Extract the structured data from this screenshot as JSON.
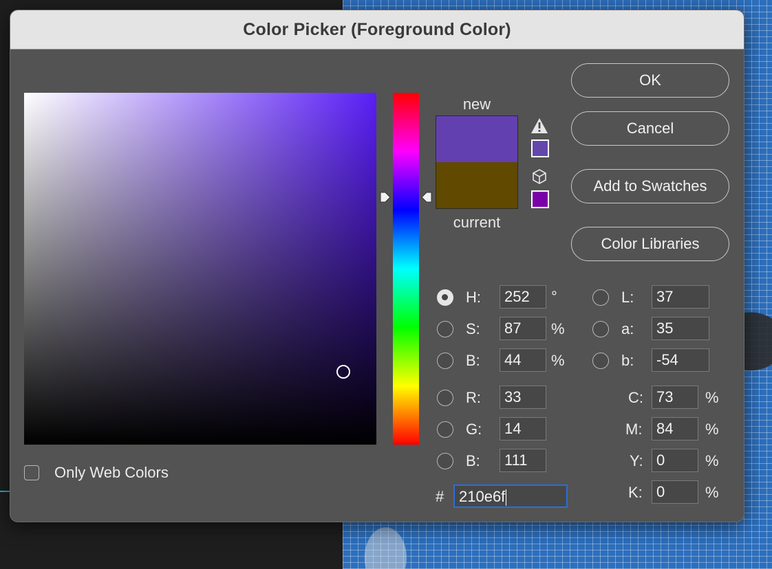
{
  "dialog": {
    "title": "Color Picker (Foreground Color)"
  },
  "buttons": {
    "ok": "OK",
    "cancel": "Cancel",
    "add_to_swatches": "Add to Swatches",
    "color_libraries": "Color Libraries"
  },
  "preview": {
    "new_label": "new",
    "current_label": "current",
    "new_color": "#6340b0",
    "current_color": "#614900",
    "gamut_warning_color": "#6447ad",
    "web_safe_color": "#7a00a8",
    "warning_icon": "gamut-warning-icon",
    "cube_icon": "web-safe-cube-icon"
  },
  "hsb": {
    "h": {
      "label": "H:",
      "value": "252",
      "unit": "°",
      "selected": true
    },
    "s": {
      "label": "S:",
      "value": "87",
      "unit": "%"
    },
    "b": {
      "label": "B:",
      "value": "44",
      "unit": "%"
    }
  },
  "rgb": {
    "r": {
      "label": "R:",
      "value": "33"
    },
    "g": {
      "label": "G:",
      "value": "14"
    },
    "b": {
      "label": "B:",
      "value": "111"
    }
  },
  "lab": {
    "l": {
      "label": "L:",
      "value": "37"
    },
    "a": {
      "label": "a:",
      "value": "35"
    },
    "b": {
      "label": "b:",
      "value": "-54"
    }
  },
  "cmyk": {
    "c": {
      "label": "C:",
      "value": "73",
      "unit": "%"
    },
    "m": {
      "label": "M:",
      "value": "84",
      "unit": "%"
    },
    "y": {
      "label": "Y:",
      "value": "0",
      "unit": "%"
    },
    "k": {
      "label": "K:",
      "value": "0",
      "unit": "%"
    }
  },
  "hex": {
    "prefix": "#",
    "value": "210e6f"
  },
  "options": {
    "only_web_colors": "Only Web Colors"
  },
  "colors": {
    "dialog_bg": "#535353",
    "field_hue": "#5a1ef7",
    "focus": "#2a6fd6"
  }
}
